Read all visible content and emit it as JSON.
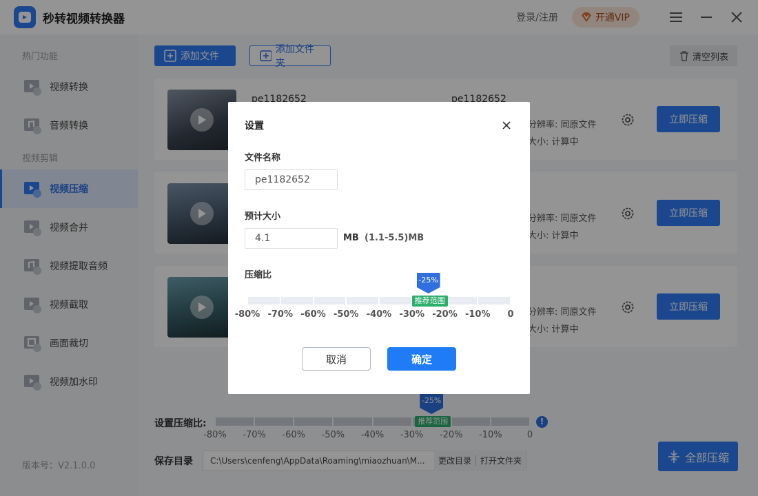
{
  "titlebar": {
    "title": "秒转视频转换器",
    "login": "登录/注册",
    "vip": "开通VIP"
  },
  "sidebar": {
    "section1": "热门功能",
    "section2": "视频剪辑",
    "items": [
      {
        "label": "视频转换"
      },
      {
        "label": "音频转换"
      },
      {
        "label": "视频压缩"
      },
      {
        "label": "视频合并"
      },
      {
        "label": "视频提取音频"
      },
      {
        "label": "视频截取"
      },
      {
        "label": "画面裁切"
      },
      {
        "label": "视频加水印"
      }
    ],
    "version": "版本号：V2.1.0.0"
  },
  "toolbar": {
    "add_file": "添加文件",
    "add_folder": "添加文件夹",
    "clear": "清空列表"
  },
  "files": [
    {
      "name": "pe1182652",
      "name2": "pe1182652",
      "resolution": "分辨率:  同原文件",
      "size": "大小:  计算中",
      "action": "立即压缩"
    },
    {
      "resolution": "分辨率:  同原文件",
      "size": "大小:  计算中",
      "action": "立即压缩"
    },
    {
      "resolution": "分辨率:  同原文件",
      "size": "大小:  计算中",
      "action": "立即压缩"
    }
  ],
  "bottom": {
    "ratio_label": "设置压缩比:",
    "ticks": [
      "-80%",
      "-70%",
      "-60%",
      "-50%",
      "-40%",
      "-30%",
      "-20%",
      "-10%",
      "0"
    ],
    "recommended": "推荐范围",
    "selected": "-25%",
    "selected_value": -25,
    "save_label": "保存目录",
    "save_path": "C:\\Users\\cenfeng\\AppData\\Roaming\\miaozhuan\\M...",
    "change_dir": "更改目录",
    "open_folder": "打开文件夹",
    "compress_all": "全部压缩"
  },
  "dialog": {
    "title": "设置",
    "filename_label": "文件名称",
    "filename_value": "pe1182652",
    "size_label": "预计大小",
    "size_value": "4.1",
    "unit": "MB",
    "range": "(1.1-5.5)MB",
    "ratio_label": "压缩比",
    "selected": "-25%",
    "selected_value": -25,
    "recommended": "推荐范围",
    "ticks": [
      "-80%",
      "-70%",
      "-60%",
      "-50%",
      "-40%",
      "-30%",
      "-20%",
      "-10%",
      "0"
    ],
    "cancel": "取消",
    "ok": "确定"
  },
  "colors": {
    "accent": "#2f7bf5",
    "recommend": "#2cae6d"
  }
}
